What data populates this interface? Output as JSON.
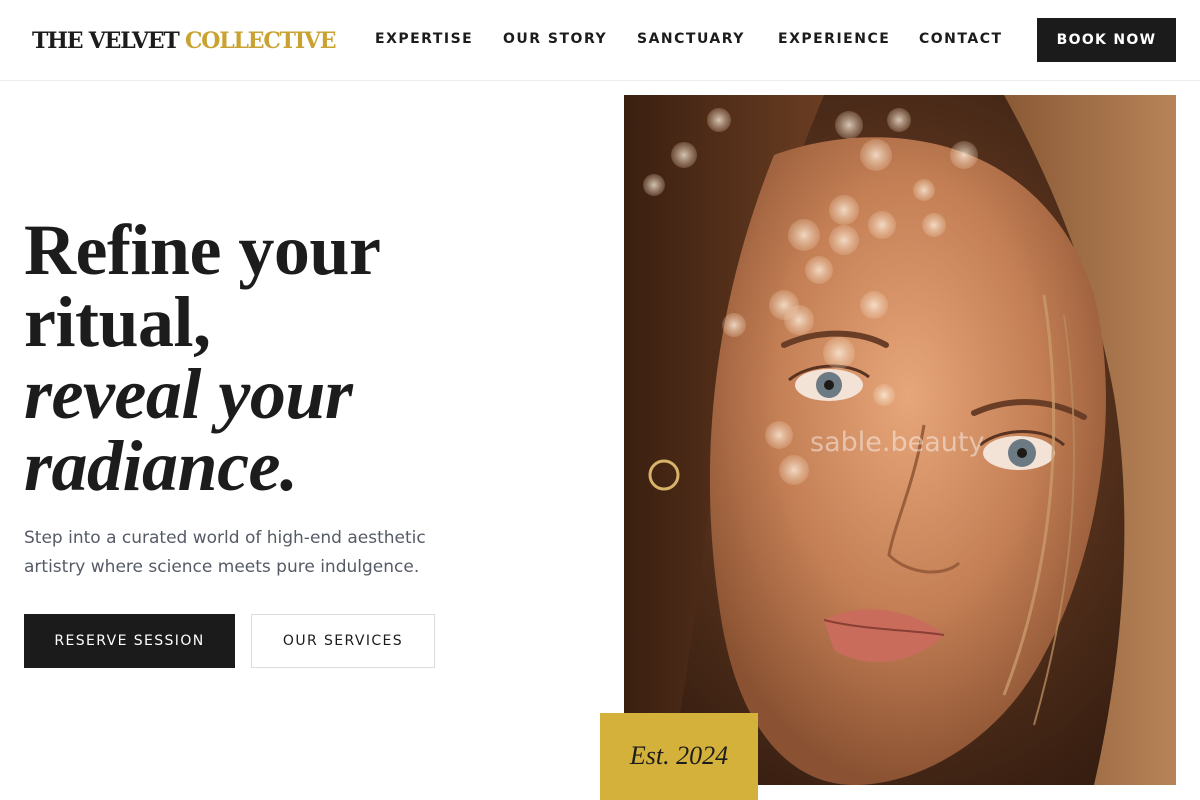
{
  "brand": {
    "name_dark": "THE VELVET",
    "name_accent": "COLLECTIVE"
  },
  "nav": {
    "items": [
      "EXPERTISE",
      "OUR STORY",
      "SANCTUARY",
      "EXPERIENCE",
      "CONTACT"
    ],
    "cta_label": "BOOK NOW"
  },
  "hero": {
    "headline_lines": [
      "Refine your",
      "ritual,",
      "reveal your",
      "radiance."
    ],
    "description": "Step into a curated world of high-end aesthetic artistry where science meets pure indulgence.",
    "primary_cta": "RESERVE SESSION",
    "secondary_cta": "OUR SERVICES"
  },
  "image": {
    "watermark": "sable.beauty"
  },
  "badge": {
    "label": "Est. 2024"
  },
  "colors": {
    "accent": "#d4b13a",
    "dark": "#1b1b1b",
    "body_text": "#555b66",
    "brand_gold": "#c9a332"
  }
}
